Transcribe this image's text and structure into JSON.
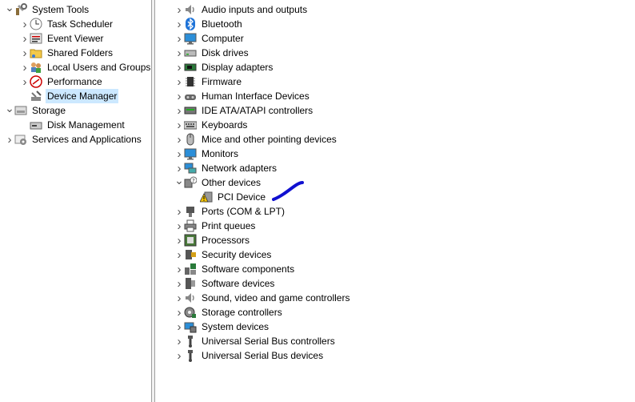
{
  "left_tree": [
    {
      "label": "System Tools",
      "level": 0,
      "expanded": true,
      "icon": "tools-icon"
    },
    {
      "label": "Task Scheduler",
      "level": 1,
      "expanded": false,
      "icon": "clock-icon"
    },
    {
      "label": "Event Viewer",
      "level": 1,
      "expanded": false,
      "icon": "event-viewer-icon"
    },
    {
      "label": "Shared Folders",
      "level": 1,
      "expanded": false,
      "icon": "shared-folder-icon"
    },
    {
      "label": "Local Users and Groups",
      "level": 1,
      "expanded": false,
      "icon": "users-icon"
    },
    {
      "label": "Performance",
      "level": 1,
      "expanded": false,
      "icon": "performance-icon"
    },
    {
      "label": "Device Manager",
      "level": 1,
      "expanded": null,
      "icon": "device-manager-icon",
      "selected": true
    },
    {
      "label": "Storage",
      "level": 0,
      "expanded": true,
      "icon": "storage-icon"
    },
    {
      "label": "Disk Management",
      "level": 1,
      "expanded": null,
      "icon": "disk-management-icon"
    },
    {
      "label": "Services and Applications",
      "level": 0,
      "expanded": false,
      "icon": "services-icon"
    }
  ],
  "device_tree": [
    {
      "label": "Audio inputs and outputs",
      "expanded": false,
      "icon": "speaker-icon"
    },
    {
      "label": "Bluetooth",
      "expanded": false,
      "icon": "bluetooth-icon"
    },
    {
      "label": "Computer",
      "expanded": false,
      "icon": "monitor-icon"
    },
    {
      "label": "Disk drives",
      "expanded": false,
      "icon": "disk-drive-icon"
    },
    {
      "label": "Display adapters",
      "expanded": false,
      "icon": "display-adapter-icon"
    },
    {
      "label": "Firmware",
      "expanded": false,
      "icon": "chip-icon"
    },
    {
      "label": "Human Interface Devices",
      "expanded": false,
      "icon": "hid-icon"
    },
    {
      "label": "IDE ATA/ATAPI controllers",
      "expanded": false,
      "icon": "ide-controller-icon"
    },
    {
      "label": "Keyboards",
      "expanded": false,
      "icon": "keyboard-icon"
    },
    {
      "label": "Mice and other pointing devices",
      "expanded": false,
      "icon": "mouse-icon"
    },
    {
      "label": "Monitors",
      "expanded": false,
      "icon": "monitor-icon"
    },
    {
      "label": "Network adapters",
      "expanded": false,
      "icon": "network-icon"
    },
    {
      "label": "Other devices",
      "expanded": true,
      "icon": "unknown-device-icon"
    },
    {
      "label": "PCI Device",
      "child": true,
      "icon": "warning-device-icon"
    },
    {
      "label": "Ports (COM & LPT)",
      "expanded": false,
      "icon": "port-icon"
    },
    {
      "label": "Print queues",
      "expanded": false,
      "icon": "printer-icon"
    },
    {
      "label": "Processors",
      "expanded": false,
      "icon": "processor-icon"
    },
    {
      "label": "Security devices",
      "expanded": false,
      "icon": "security-device-icon"
    },
    {
      "label": "Software components",
      "expanded": false,
      "icon": "software-component-icon"
    },
    {
      "label": "Software devices",
      "expanded": false,
      "icon": "software-device-icon"
    },
    {
      "label": "Sound, video and game controllers",
      "expanded": false,
      "icon": "speaker-icon"
    },
    {
      "label": "Storage controllers",
      "expanded": false,
      "icon": "storage-controller-icon"
    },
    {
      "label": "System devices",
      "expanded": false,
      "icon": "system-device-icon"
    },
    {
      "label": "Universal Serial Bus controllers",
      "expanded": false,
      "icon": "usb-icon"
    },
    {
      "label": "Universal Serial Bus devices",
      "expanded": false,
      "icon": "usb-icon"
    }
  ],
  "colors": {
    "selection": "#cce8ff",
    "annotation": "#1010d0",
    "warning": "#f5c400"
  }
}
